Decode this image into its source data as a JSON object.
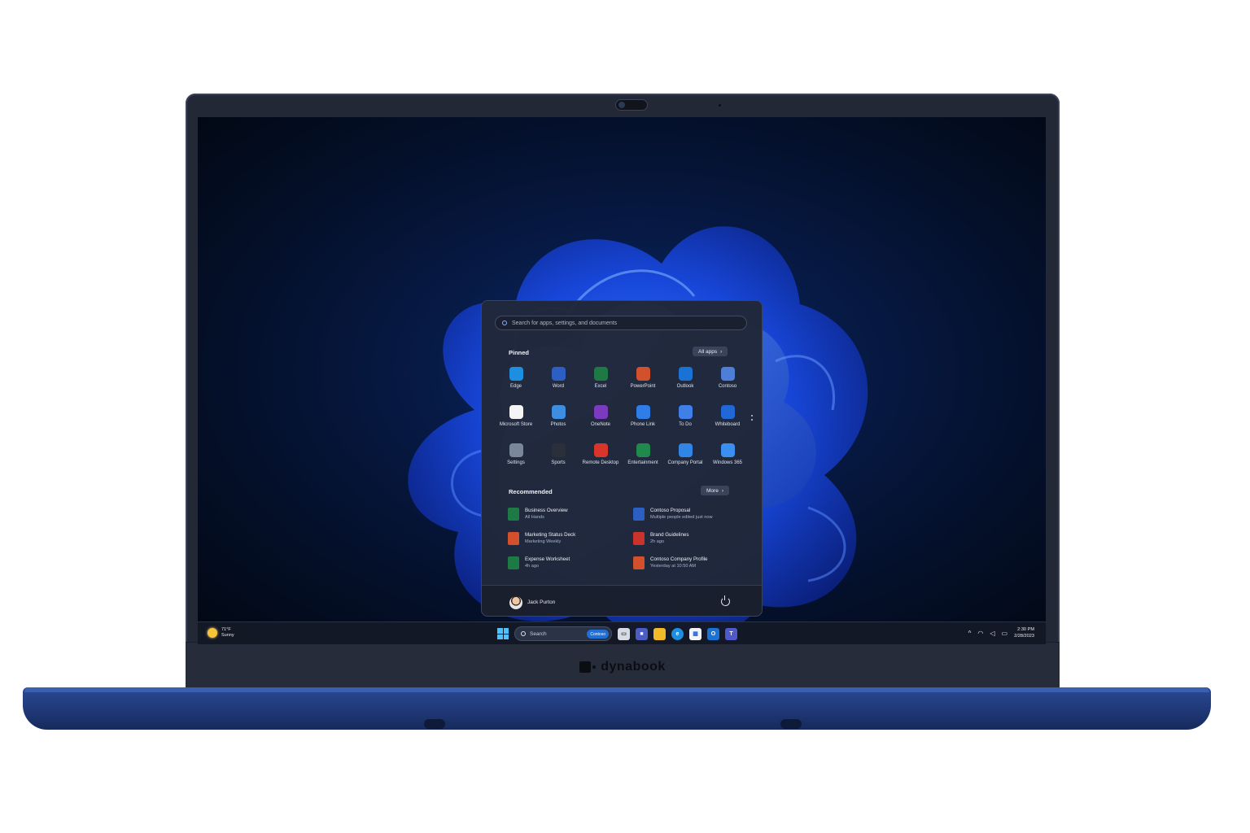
{
  "device": {
    "brand": "dynabook"
  },
  "start_menu": {
    "search_placeholder": "Search for apps, settings, and documents",
    "pinned_title": "Pinned",
    "all_apps_label": "All apps",
    "pinned_apps": [
      {
        "label": "Edge",
        "icon": "edge-icon",
        "color": "#1d8fe0"
      },
      {
        "label": "Word",
        "icon": "word-icon",
        "color": "#2b5fc1"
      },
      {
        "label": "Excel",
        "icon": "excel-icon",
        "color": "#1d7a45"
      },
      {
        "label": "PowerPoint",
        "icon": "powerpoint-icon",
        "color": "#d2502b"
      },
      {
        "label": "Outlook",
        "icon": "outlook-icon",
        "color": "#1a73d4"
      },
      {
        "label": "Contoso",
        "icon": "contoso-icon",
        "color": "#4d7fd6"
      },
      {
        "label": "Microsoft Store",
        "icon": "store-icon",
        "color": "#f4f4f4"
      },
      {
        "label": "Photos",
        "icon": "photos-icon",
        "color": "#3d8de0"
      },
      {
        "label": "OneNote",
        "icon": "onenote-icon",
        "color": "#7a3bbf"
      },
      {
        "label": "Phone Link",
        "icon": "phone-link-icon",
        "color": "#2f7de6"
      },
      {
        "label": "To Do",
        "icon": "todo-icon",
        "color": "#3f7fe8"
      },
      {
        "label": "Whiteboard",
        "icon": "whiteboard-icon",
        "color": "#2167d6"
      },
      {
        "label": "Settings",
        "icon": "gear-icon",
        "color": "#7a8699"
      },
      {
        "label": "Sports",
        "icon": "sports-icon",
        "color": "#2a2f3a"
      },
      {
        "label": "Remote Desktop",
        "icon": "remote-desktop-icon",
        "color": "#d9352b"
      },
      {
        "label": "Entertainment",
        "icon": "entertainment-icon",
        "color": "#1f8a4c"
      },
      {
        "label": "Company Portal",
        "icon": "company-portal-icon",
        "color": "#2f86e6"
      },
      {
        "label": "Windows 365",
        "icon": "windows365-icon",
        "color": "#3a8ff0"
      }
    ],
    "recommended_title": "Recommended",
    "more_label": "More",
    "recommended": [
      {
        "name": "Business Overview",
        "sub": "All Hands",
        "icon": "excel-file-icon",
        "color": "#1d7a45"
      },
      {
        "name": "Contoso Proposal",
        "sub": "Multiple people edited just now",
        "icon": "word-file-icon",
        "color": "#2b5fc1"
      },
      {
        "name": "Marketing Status Deck",
        "sub": "Marketing Weekly",
        "icon": "powerpoint-file-icon",
        "color": "#d2502b"
      },
      {
        "name": "Brand Guidelines",
        "sub": "2h ago",
        "icon": "pdf-file-icon",
        "color": "#c9332b"
      },
      {
        "name": "Expense Worksheet",
        "sub": "4h ago",
        "icon": "excel-file-icon",
        "color": "#1d7a45"
      },
      {
        "name": "Contoso Company Profile",
        "sub": "Yesterday at 10:50 AM",
        "icon": "powerpoint-file-icon",
        "color": "#d2502b"
      }
    ],
    "user_name": "Jack Purton"
  },
  "taskbar": {
    "weather_temp": "71°F",
    "weather_desc": "Sunny",
    "search_label": "Search",
    "search_badge": "Contoso",
    "time": "2:30 PM",
    "date": "2/28/2023"
  }
}
